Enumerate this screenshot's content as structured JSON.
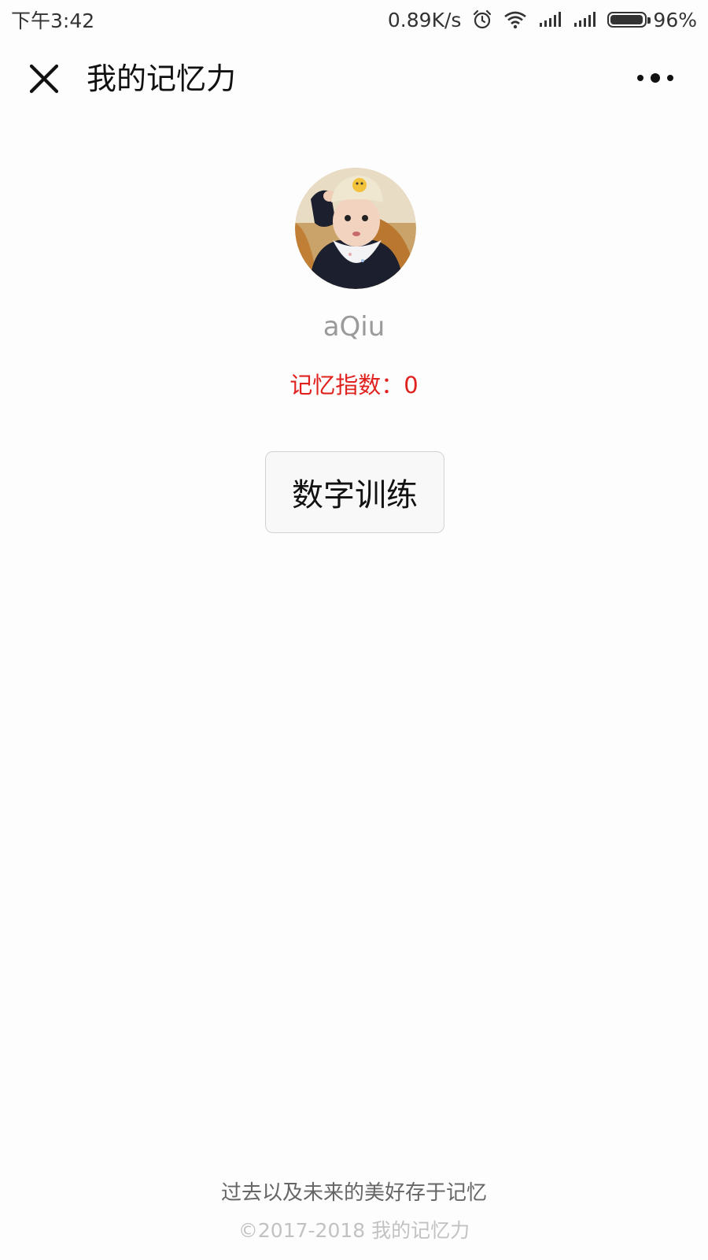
{
  "status_bar": {
    "time": "下午3:42",
    "network_speed": "0.89K/s",
    "battery_percent": "96%",
    "battery_level": 0.96,
    "icons": [
      "alarm-icon",
      "wifi-icon",
      "signal-icon",
      "signal-icon"
    ]
  },
  "nav": {
    "title": "我的记忆力",
    "close_icon": "close-icon",
    "more_icon": "more-icon"
  },
  "profile": {
    "username": "aQiu",
    "memory_index": "记忆指数：0"
  },
  "actions": {
    "number_training_label": "数字训练"
  },
  "footer": {
    "slogan": "过去以及未来的美好存于记忆",
    "copyright": "©2017-2018 我的记忆力"
  },
  "colors": {
    "background": "#fdfdfd",
    "memory_index": "#e0221f",
    "username": "#9a9a9a",
    "button_bg": "#f8f8f8",
    "button_border": "#d2d2d2",
    "slogan": "#666666",
    "copyright": "#c2c2c2"
  }
}
